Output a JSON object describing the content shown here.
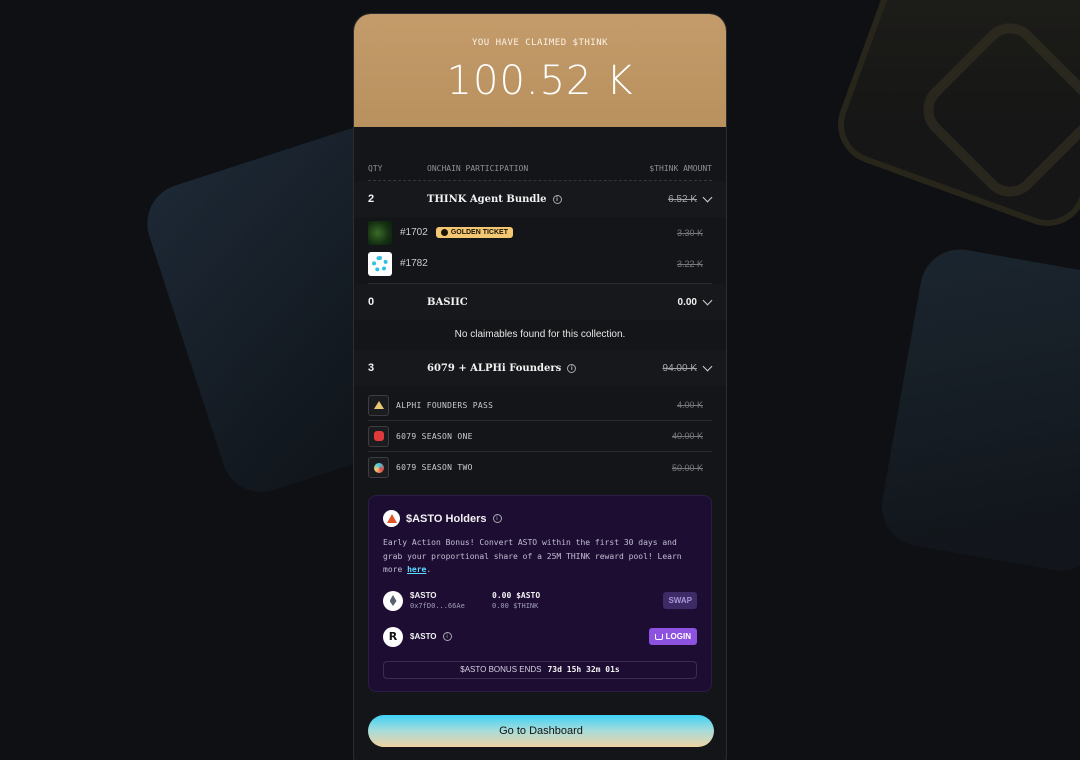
{
  "hero": {
    "label": "YOU HAVE CLAIMED $THINK",
    "amount": "100.52 K"
  },
  "table": {
    "headers": {
      "qty": "QTY",
      "participation": "ONCHAIN PARTICIPATION",
      "amount": "$THINK AMOUNT"
    },
    "groups": [
      {
        "qty": "2",
        "name": "THINK Agent Bundle",
        "amount": "6.52 K",
        "items": [
          {
            "id": "#1702",
            "badge": "GOLDEN TICKET",
            "amount": "3.30 K"
          },
          {
            "id": "#1782",
            "amount": "3.22 K"
          }
        ]
      },
      {
        "qty": "0",
        "name": "BASIIC",
        "amount": "0.00",
        "empty_text": "No claimables found for this collection."
      },
      {
        "qty": "3",
        "name": "6079 + ALPHi Founders",
        "amount": "94.00 K",
        "items": [
          {
            "name": "ALPHI FOUNDERS PASS",
            "amount": "4.00 K"
          },
          {
            "name": "6079 SEASON ONE",
            "amount": "40.00 K"
          },
          {
            "name": "6079 SEASON TWO",
            "amount": "50.00 K"
          }
        ]
      }
    ]
  },
  "asto": {
    "title": "$ASTO Holders",
    "desc_before": "Early Action Bonus! Convert ASTO within the first 30 days and grab your proportional share of a 25M THINK reward pool! Learn more ",
    "desc_link": "here",
    "desc_after": ".",
    "wallet": {
      "token": "$ASTO",
      "address": "0x7fD0...66Ae",
      "balance": "0.00 $ASTO",
      "think_balance": "0.00 $THINK",
      "swap_label": "SWAP"
    },
    "login": {
      "token": "$ASTO",
      "button_label": "LOGIN"
    },
    "bonus": {
      "label": "$ASTO BONUS ENDS",
      "time": "73d 15h 32m 01s"
    }
  },
  "footer": {
    "dashboard_label": "Go to Dashboard"
  }
}
